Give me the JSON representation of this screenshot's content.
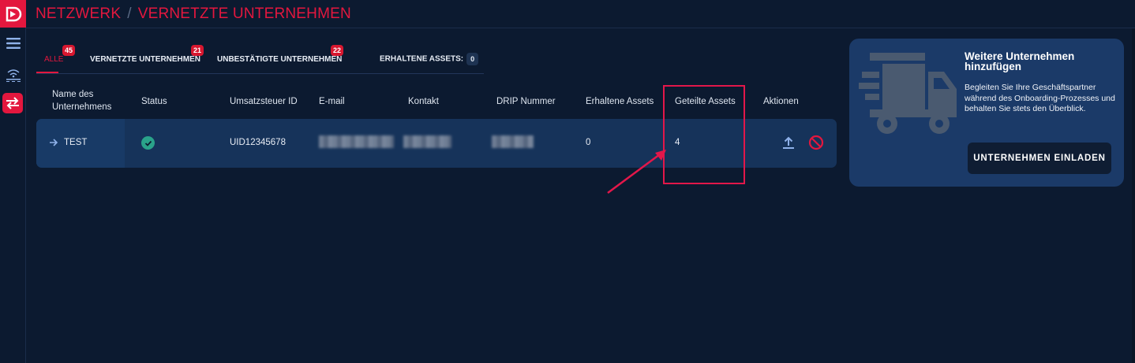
{
  "header": {
    "crumbs": [
      "NETZWERK",
      "VERNETZTE UNTERNEHMEN"
    ],
    "separator": "/"
  },
  "tabs": [
    {
      "label": "ALLE",
      "badge": "45",
      "active": true
    },
    {
      "label": "VERNETZTE UNTERNEHMEN",
      "badge": "21"
    },
    {
      "label": "UNBESTÄTIGTE UNTERNEHMEN",
      "badge": "22"
    },
    {
      "label": "ERHALTENE ASSETS:",
      "badge": "0"
    }
  ],
  "table": {
    "columns": {
      "name_line1": "Name des",
      "name_line2": "Unternehmens",
      "status": "Status",
      "vat": "Umsatzsteuer ID",
      "email": "E-mail",
      "contact": "Kontakt",
      "drip": "DRIP Nummer",
      "received": "Erhaltene Assets",
      "shared": "Geteilte Assets",
      "actions": "Aktionen"
    },
    "rows": [
      {
        "name": "TEST",
        "vat": "UID12345678",
        "received": "0",
        "shared": "4"
      }
    ]
  },
  "card": {
    "title": "Weitere Unternehmen hinzufügen",
    "text": "Begleiten Sie Ihre Geschäftspartner während des Onboarding-Prozesses und behalten Sie stets den Überblick.",
    "button": "UNTERNEHMEN EINLADEN"
  },
  "colors": {
    "background": "#0c1a30",
    "accent": "#e3173e",
    "row": "#16335a",
    "card": "#1b3a68",
    "status_ok": "#2aa38a"
  },
  "icons": [
    "logo-icon",
    "menu-icon",
    "wifi-icon",
    "swap-icon",
    "arrow-right-icon",
    "check-circle-icon",
    "upload-icon",
    "block-icon",
    "truck-icon"
  ]
}
